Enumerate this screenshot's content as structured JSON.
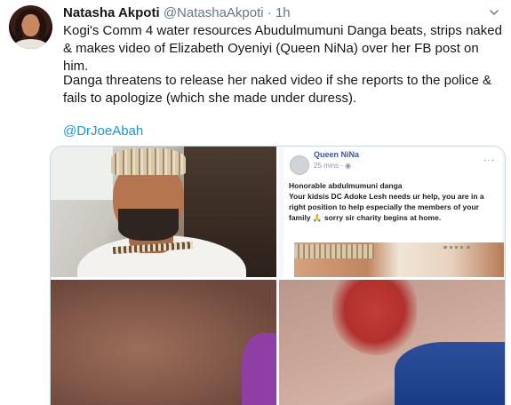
{
  "author": {
    "name": "Natasha Akpoti",
    "handle": "@NatashaAkpoti",
    "separator": "·",
    "time": "1h"
  },
  "tweet": {
    "paragraph1": "Kogi's Comm 4 water resources Abudulmumuni Danga beats, strips naked & makes video of Elizabeth Oyeniyi (Queen NiNa) over her FB post on him.",
    "paragraph2": "Danga threatens to release her naked video if she reports to the police & fails to apologize (which she made under duress).",
    "mention": "@DrJoeAbah"
  },
  "media": {
    "fb_post": {
      "author": "Queen NiNa",
      "time": "25 mins · ",
      "more": "···",
      "text": "Honorable abdulmumuni danga\nYour kidsis  DC Adoke Lesh needs ur help, you are in a right position to help especially the members of your family 🙏 sorry sir charity begins at home."
    }
  },
  "icons": {
    "caret": "chevron-down-icon"
  },
  "colors": {
    "link": "#1b95e0",
    "secondary_text": "#657786",
    "border": "#ccd6dd"
  }
}
